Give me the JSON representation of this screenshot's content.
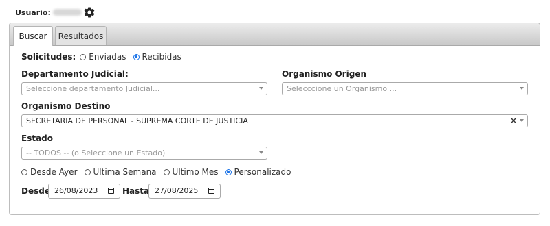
{
  "user": {
    "label": "Usuario:",
    "name_hidden": ""
  },
  "tabs": [
    {
      "label": "Buscar"
    },
    {
      "label": "Resultados"
    }
  ],
  "solicitudes": {
    "label": "Solicitudes:",
    "options": [
      {
        "label": "Enviadas",
        "checked": false
      },
      {
        "label": "Recibidas",
        "checked": true
      }
    ]
  },
  "departamento": {
    "label": "Departamento Judicial:",
    "placeholder": "Seleccione departamento Judicial..."
  },
  "origen": {
    "label": "Organismo Origen",
    "placeholder": "Selecccione un Organismo ..."
  },
  "destino": {
    "label": "Organismo Destino",
    "value": "SECRETARIA DE PERSONAL - SUPREMA CORTE DE JUSTICIA",
    "clear": "×"
  },
  "estado": {
    "label": "Estado",
    "placeholder": "-- TODOS -- (o Seleccione un Estado)"
  },
  "periodo": {
    "options": [
      {
        "label": "Desde Ayer",
        "checked": false
      },
      {
        "label": "Ultima Semana",
        "checked": false
      },
      {
        "label": "Ultimo Mes",
        "checked": false
      },
      {
        "label": "Personalizado",
        "checked": true
      }
    ]
  },
  "fechas": {
    "desde_label": "Desde",
    "desde_value": "26/08/2023",
    "hasta_label": "Hasta",
    "hasta_value": "27/08/2025"
  }
}
